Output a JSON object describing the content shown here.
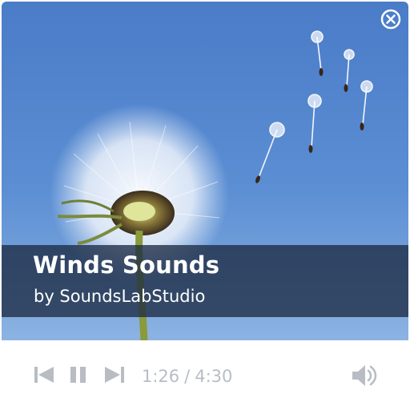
{
  "track": {
    "title": "Winds Sounds",
    "artist_line": "by SoundsLabStudio"
  },
  "playback": {
    "state": "playing",
    "current_time": "1:26",
    "separator": "/",
    "duration": "4:30"
  },
  "icons": {
    "close": "close-circle-icon",
    "previous": "skip-previous-icon",
    "pause": "pause-icon",
    "next": "skip-next-icon",
    "volume": "volume-icon",
    "artwork": "dandelion-sky-image"
  },
  "colors": {
    "caption_bg": "#1e2c44",
    "controls_icon": "#b8bdc4",
    "text_light": "#ffffff"
  }
}
